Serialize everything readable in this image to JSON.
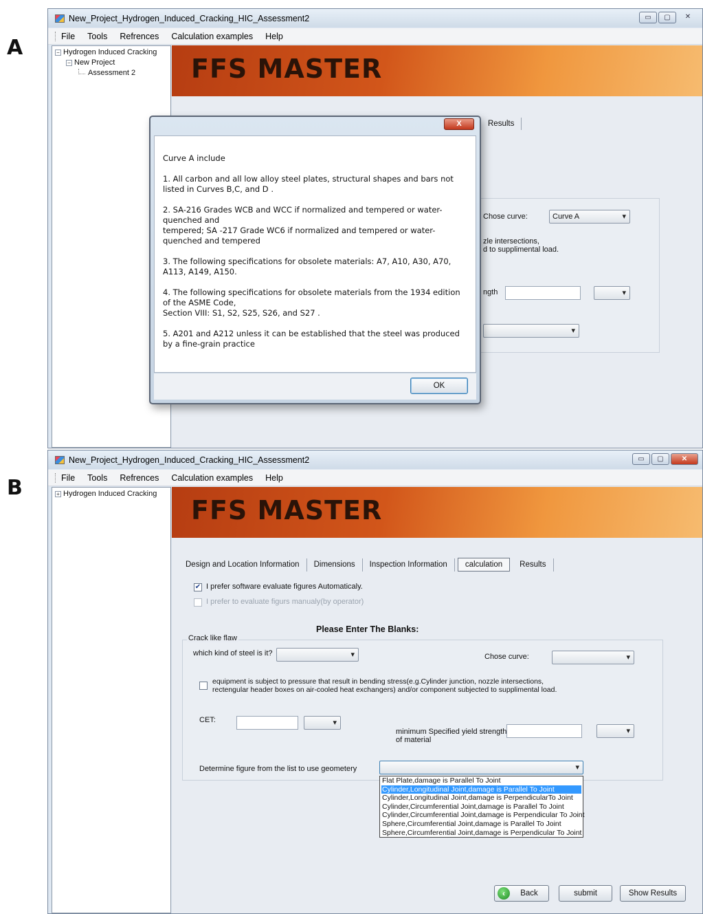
{
  "panels": {
    "a_letter": "A",
    "b_letter": "B"
  },
  "window": {
    "title": "New_Project_Hydrogen_Induced_Cracking_HIC_Assessment2",
    "menu": [
      "File",
      "Tools",
      "Refrences",
      "Calculation examples",
      "Help"
    ],
    "banner": "FFS MASTER"
  },
  "panel_a": {
    "tree": {
      "root": "Hydrogen Induced Cracking",
      "project": "New Project",
      "assessment": "Assessment 2"
    },
    "visible_tab": "Results",
    "chose_curve_label": "Chose curve:",
    "chose_curve_value": "Curve A",
    "partial_text_1": "zle intersections,",
    "partial_text_2": "d to supplimental load.",
    "partial_text_3": "ngth",
    "dialog": {
      "close": "X",
      "heading": "Curve  A include",
      "items": [
        "1. All carbon and all low alloy steel plates, structural shapes and bars not listed in Curves B,C, and D .",
        "2. SA-216 Grades WCB and WCC if normalized and tempered or water-quenched and\ntempered; SA -217 Grade WC6 if normalized and tempered or water-quenched and tempered",
        "3. The following specifications for obsolete materials: A7, A10, A30, A70, A113, A149, A150.",
        "4. The following specifications for obsolete materials from the 1934 edition of the ASME Code,\nSection VIII: S1, S2, S25, S26, and S27 .",
        "5. A201 and A212 unless it can be established that the steel was produced by a fine-grain practice"
      ],
      "ok": "OK"
    }
  },
  "panel_b": {
    "tree_root": "Hydrogen Induced Cracking",
    "tabs": [
      "Design and Location Information",
      "Dimensions",
      "Inspection Information",
      "calculation",
      "Results"
    ],
    "active_tab": "calculation",
    "auto_eval_label": "I prefer software evaluate figures Automaticaly.",
    "auto_eval_checked": true,
    "manual_eval_label": "I prefer to evaluate figurs manualy(by operator)",
    "manual_eval_checked": false,
    "please_enter": "Please Enter The Blanks:",
    "group_title": "Crack like flaw",
    "steel_kind_label": "which kind of steel is it?",
    "steel_kind_value": "",
    "chose_curve_label": "Chose curve:",
    "chose_curve_value": "",
    "bending_label_1": "equipment is subject to pressure that result in bending stress(e.g.Cylinder junction, nozzle intersections,",
    "bending_label_2": "rectengular header boxes on air-cooled heat exchangers) and/or component subjected to supplimental load.",
    "bending_checked": false,
    "cet_label": "CET:",
    "cet_value": "",
    "min_yield_label_1": "minimum Specified yield strength",
    "min_yield_label_2": "of material",
    "min_yield_value": "",
    "geometry_label": "Determine figure from the list to use geometery",
    "geometry_options": [
      "Flat Plate,damage is Parallel To Joint",
      "Cylinder,Longitudinal Joint,damage is Parallel To Joint",
      "Cylinder,Longitudinal Joint,damage is PerpendicularTo Joint",
      "Cylinder,Circumferential Joint,damage is Parallel To Joint",
      "Cylinder,Circumferential Joint,damage is Perpendicular To Joint",
      "Sphere,Circumferential Joint,damage is Parallel To Joint",
      "Sphere,Circumferential Joint,damage is Perpendicular To Joint"
    ],
    "geometry_highlighted_index": 1,
    "back": "Back",
    "submit": "submit",
    "show_results": "Show Results"
  }
}
